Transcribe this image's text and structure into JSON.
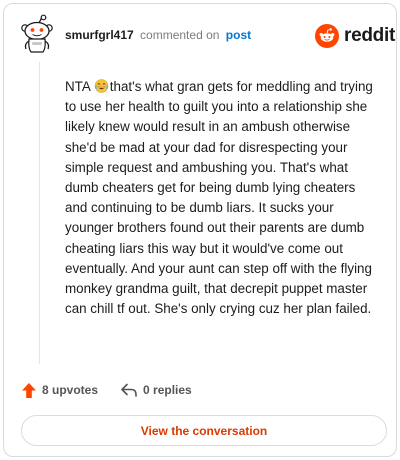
{
  "comment": {
    "username": "smurfgrl417",
    "action_text": "commented on",
    "post_link_label": "post",
    "body_prefix": "NTA",
    "body_text": "that's what gran gets for meddling and trying to use her health to guilt you into a relationship she likely knew would result in an ambush otherwise she'd be mad at your dad for disrespecting your simple request and ambushing you. That's what dumb cheaters get for being dumb lying cheaters and continuing to be dumb liars. It sucks your younger brothers found out their parents are dumb cheating liars this way but it would've come out eventually. And your aunt can step off with the flying monkey grandma guilt, that decrepit puppet master can chill tf out. She's only crying cuz her plan failed."
  },
  "brand": {
    "name": "reddit",
    "color": "#ff4500"
  },
  "actions": {
    "upvotes_label": "8 upvotes",
    "replies_label": "0 replies"
  },
  "cta": {
    "label": "View the conversation"
  },
  "icons": {
    "avatar": "snoo-avatar-icon",
    "brand": "reddit-logo-icon",
    "upvote": "upvote-arrow-icon",
    "reply": "reply-arrow-icon",
    "emoji": "laughing-emoji-icon"
  },
  "colors": {
    "accent": "#ff4500",
    "link": "#0079d3",
    "cta_text": "#d93a00"
  }
}
